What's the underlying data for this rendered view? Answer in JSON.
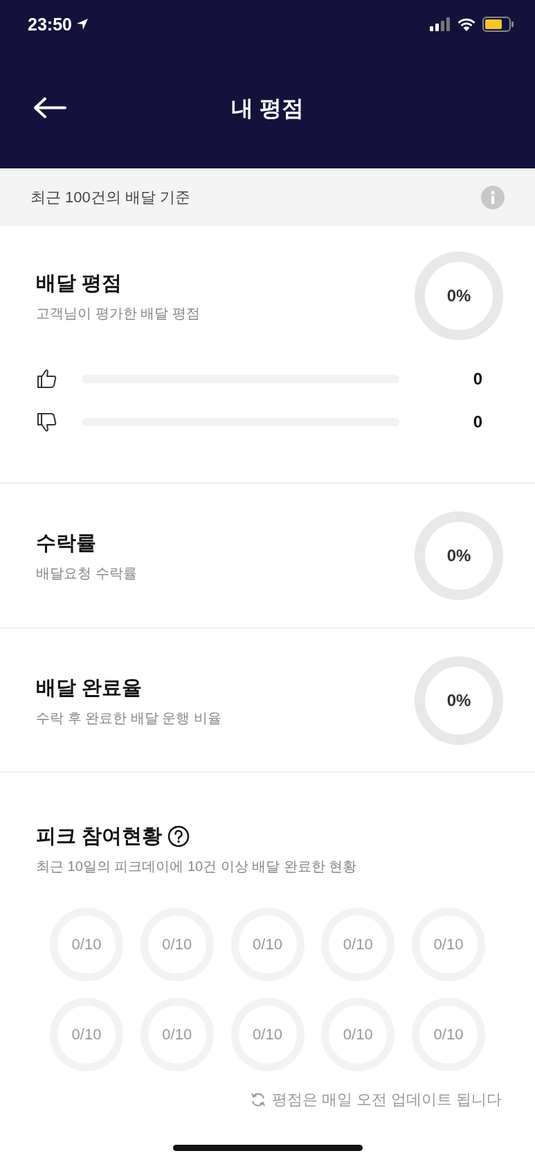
{
  "status_bar": {
    "time": "23:50"
  },
  "header": {
    "title": "내 평점"
  },
  "basis": {
    "text": "최근 100건의 배달 기준"
  },
  "metrics": [
    {
      "title": "배달 평점",
      "subtitle": "고객님이 평가한 배달 평점",
      "value": "0%",
      "votes": [
        {
          "kind": "up",
          "count": "0"
        },
        {
          "kind": "down",
          "count": "0"
        }
      ]
    },
    {
      "title": "수락률",
      "subtitle": "배달요청 수락률",
      "value": "0%"
    },
    {
      "title": "배달 완료율",
      "subtitle": "수락 후 완료한 배달 운행 비율",
      "value": "0%"
    }
  ],
  "peak": {
    "title": "피크 참여현황",
    "subtitle": "최근 10일의 피크데이에 10건 이상 배달 완료한 현황",
    "days": [
      {
        "value": "0/10"
      },
      {
        "value": "0/10"
      },
      {
        "value": "0/10"
      },
      {
        "value": "0/10"
      },
      {
        "value": "0/10"
      },
      {
        "value": "0/10"
      },
      {
        "value": "0/10"
      },
      {
        "value": "0/10"
      },
      {
        "value": "0/10"
      },
      {
        "value": "0/10"
      }
    ]
  },
  "footer": {
    "text": "평점은 매일 오전 업데이트 됩니다"
  }
}
